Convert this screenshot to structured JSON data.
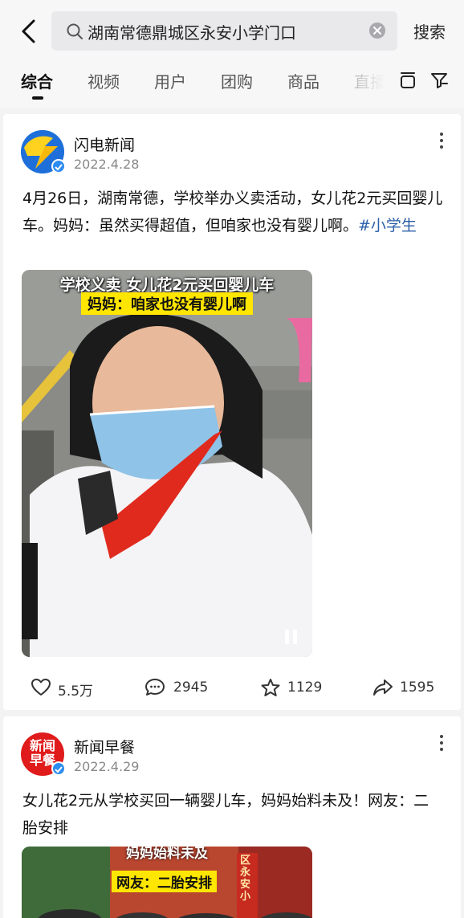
{
  "search": {
    "query": "湖南常德鼎城区永安小学门口",
    "button_label": "搜索"
  },
  "tabs": [
    {
      "label": "综合",
      "active": true
    },
    {
      "label": "视频",
      "active": false
    },
    {
      "label": "用户",
      "active": false
    },
    {
      "label": "团购",
      "active": false
    },
    {
      "label": "商品",
      "active": false
    },
    {
      "label": "直播",
      "active": false
    }
  ],
  "posts": [
    {
      "author": "闪电新闻",
      "date": "2022.4.28",
      "text": "4月26日，湖南常德，学校举办义卖活动，女儿花2元买回婴儿车。妈妈：虽然买得超值，但咱家也没有婴儿啊。",
      "hashtag": "#小学生",
      "video_caption_1": "学校义卖 女儿花2元买回婴儿车",
      "video_caption_2": "妈妈：咱家也没有婴儿啊",
      "likes": "5.5万",
      "comments": "2945",
      "favorites": "1129",
      "shares": "1595"
    },
    {
      "author": "新闻早餐",
      "avatar_text_1": "新闻",
      "avatar_text_2": "早餐",
      "date": "2022.4.29",
      "text": "女儿花2元从学校买回一辆婴儿车，妈妈始料未及！网友：二胎安排",
      "video_caption_1": "妈妈始料未及",
      "video_caption_2": "网友：二胎安排",
      "banner_text": "区永安小"
    }
  ],
  "colors": {
    "accent_blue": "#2b5ea8",
    "verified_blue": "#2c8cf0",
    "caption_yellow": "#ffe600"
  }
}
